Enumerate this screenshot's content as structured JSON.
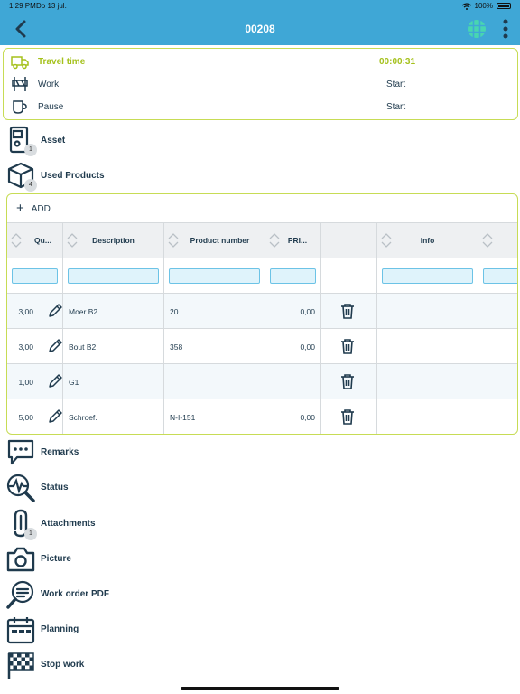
{
  "status_bar": {
    "time": "1:29 PM",
    "date": "Do 13 jul.",
    "battery": "100%"
  },
  "header": {
    "title": "00208"
  },
  "time_tracking": {
    "travel": {
      "label": "Travel time",
      "value": "00:00:31"
    },
    "work": {
      "label": "Work",
      "action": "Start"
    },
    "pause": {
      "label": "Pause",
      "action": "Start"
    }
  },
  "asset": {
    "label": "Asset",
    "badge": "1"
  },
  "used_products": {
    "label": "Used Products",
    "badge": "4",
    "add_label": "ADD",
    "columns": [
      "Qu...",
      "Description",
      "Product number",
      "PRI...",
      "",
      "info",
      ""
    ],
    "rows": [
      {
        "qty": "3,00",
        "description": "Moer B2",
        "product_number": "20",
        "price": "0,00"
      },
      {
        "qty": "3,00",
        "description": "Bout B2",
        "product_number": "358",
        "price": "0,00"
      },
      {
        "qty": "1,00",
        "description": "G1",
        "product_number": "",
        "price": ""
      },
      {
        "qty": "5,00",
        "description": "Schroef.",
        "product_number": "N-I-151",
        "price": "0,00"
      }
    ]
  },
  "menu": {
    "remarks": "Remarks",
    "status": "Status",
    "attachments": "Attachments",
    "attachments_badge": "1",
    "picture": "Picture",
    "work_order_pdf": "Work order PDF",
    "planning": "Planning",
    "stop_work": "Stop work"
  },
  "colors": {
    "header": "#3fa7d6",
    "accent": "#a5c11c",
    "icon": "#1f3a4d",
    "border": "#c7dc55"
  }
}
